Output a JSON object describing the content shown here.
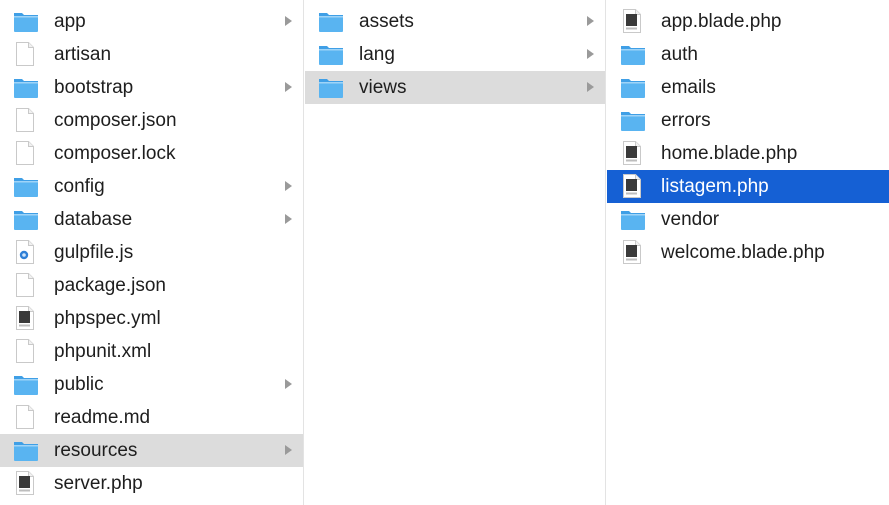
{
  "colors": {
    "folder": "#59b4f1",
    "folder_tab": "#3f9fe6",
    "selection": "#1560d4",
    "path_highlight": "#dcdcdc",
    "chevron": "#9a9a9a"
  },
  "columns": [
    {
      "items": [
        {
          "name": "app",
          "icon": "folder-icon",
          "chevron": true
        },
        {
          "name": "artisan",
          "icon": "document-icon"
        },
        {
          "name": "bootstrap",
          "icon": "folder-icon",
          "chevron": true
        },
        {
          "name": "composer.json",
          "icon": "document-icon"
        },
        {
          "name": "composer.lock",
          "icon": "document-icon"
        },
        {
          "name": "config",
          "icon": "folder-icon",
          "chevron": true
        },
        {
          "name": "database",
          "icon": "folder-icon",
          "chevron": true
        },
        {
          "name": "gulpfile.js",
          "icon": "js-file-icon"
        },
        {
          "name": "package.json",
          "icon": "document-icon"
        },
        {
          "name": "phpspec.yml",
          "icon": "yml-file-icon"
        },
        {
          "name": "phpunit.xml",
          "icon": "document-icon"
        },
        {
          "name": "public",
          "icon": "folder-icon",
          "chevron": true
        },
        {
          "name": "readme.md",
          "icon": "document-icon"
        },
        {
          "name": "resources",
          "icon": "folder-icon",
          "chevron": true,
          "state": "active"
        },
        {
          "name": "server.php",
          "icon": "php-file-icon"
        }
      ]
    },
    {
      "items": [
        {
          "name": "assets",
          "icon": "folder-icon",
          "chevron": true
        },
        {
          "name": "lang",
          "icon": "folder-icon",
          "chevron": true
        },
        {
          "name": "views",
          "icon": "folder-icon",
          "chevron": true,
          "state": "active"
        }
      ]
    },
    {
      "items": [
        {
          "name": "app.blade.php",
          "icon": "php-file-icon"
        },
        {
          "name": "auth",
          "icon": "folder-icon"
        },
        {
          "name": "emails",
          "icon": "folder-icon"
        },
        {
          "name": "errors",
          "icon": "folder-icon"
        },
        {
          "name": "home.blade.php",
          "icon": "php-file-icon"
        },
        {
          "name": "listagem.php",
          "icon": "php-file-icon",
          "state": "selected"
        },
        {
          "name": "vendor",
          "icon": "folder-icon"
        },
        {
          "name": "welcome.blade.php",
          "icon": "php-file-icon"
        }
      ]
    }
  ]
}
